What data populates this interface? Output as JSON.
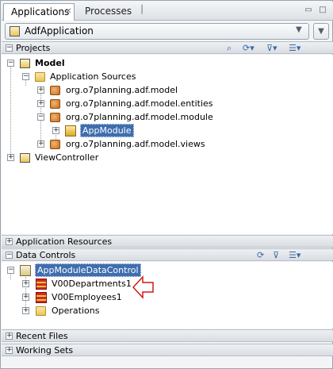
{
  "tabs": [
    {
      "label": "Applications",
      "active": true
    },
    {
      "label": "Processes",
      "active": false
    }
  ],
  "application_selector": {
    "value": "AdfApplication"
  },
  "projects": {
    "header": "Projects",
    "tree": [
      {
        "label": "Model",
        "bold": true
      },
      {
        "label": "Application Sources"
      },
      {
        "label": "org.o7planning.adf.model"
      },
      {
        "label": "org.o7planning.adf.model.entities"
      },
      {
        "label": "org.o7planning.adf.model.module"
      },
      {
        "label": "AppModule"
      },
      {
        "label": "org.o7planning.adf.model.views"
      },
      {
        "label": "ViewController"
      }
    ]
  },
  "application_resources": {
    "header": "Application Resources"
  },
  "data_controls": {
    "header": "Data Controls",
    "tree": [
      {
        "label": "AppModuleDataControl"
      },
      {
        "label": "V00Departments1"
      },
      {
        "label": "V00Employees1"
      },
      {
        "label": "Operations"
      }
    ]
  },
  "recent_files": {
    "header": "Recent Files"
  },
  "working_sets": {
    "header": "Working Sets"
  },
  "colors": {
    "selection": "#3f6eaf",
    "arrow": "#d01818"
  }
}
